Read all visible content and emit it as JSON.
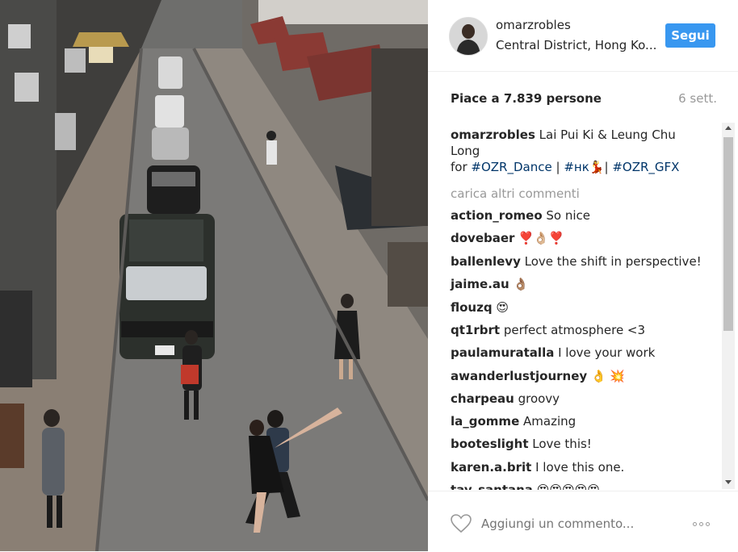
{
  "header": {
    "username": "omarzrobles",
    "location": "Central District, Hong Ko...",
    "follow_label": "Segui"
  },
  "stats": {
    "likes": "Piace a 7.839 persone",
    "date": "6 sett."
  },
  "caption": {
    "username": "omarzrobles",
    "text_line1": "Lai Pui Ki & Leung Chu",
    "text_line2": "Long",
    "text_for": "for",
    "tag1": "#OZR_Dance",
    "sep1": "|",
    "tag2": "#нк💃",
    "sep2": "|",
    "tag3": "#OZR_GFX"
  },
  "load_more": "carica altri commenti",
  "comments": [
    {
      "user": "action_romeo",
      "text": "So nice"
    },
    {
      "user": "dovebaer",
      "text": "❣️👌🏼❣️"
    },
    {
      "user": "ballenlevy",
      "text": "Love the shift in perspective!"
    },
    {
      "user": "jaime.au",
      "text": "👌🏽"
    },
    {
      "user": "flouzq",
      "text": "😍"
    },
    {
      "user": "qt1rbrt",
      "text": "perfect atmosphere <3"
    },
    {
      "user": "paulamuratalla",
      "text": "I love your work"
    },
    {
      "user": "awanderlustjourney",
      "text": "👌 💥"
    },
    {
      "user": "charpeau",
      "text": "groovy"
    },
    {
      "user": "la_gomme",
      "text": "Amazing"
    },
    {
      "user": "booteslight",
      "text": "Love this!"
    },
    {
      "user": "karen.a.brit",
      "text": "I love this one."
    },
    {
      "user": "tay_santana",
      "text": "😍😍😍😍😍"
    }
  ],
  "footer": {
    "comment_placeholder": "Aggiungi un commento..."
  },
  "icons": {
    "heart": "heart-icon",
    "more": "more-options-icon"
  },
  "colors": {
    "follow_button": "#3897f0",
    "hashtag": "#003569",
    "muted_text": "#999999"
  }
}
